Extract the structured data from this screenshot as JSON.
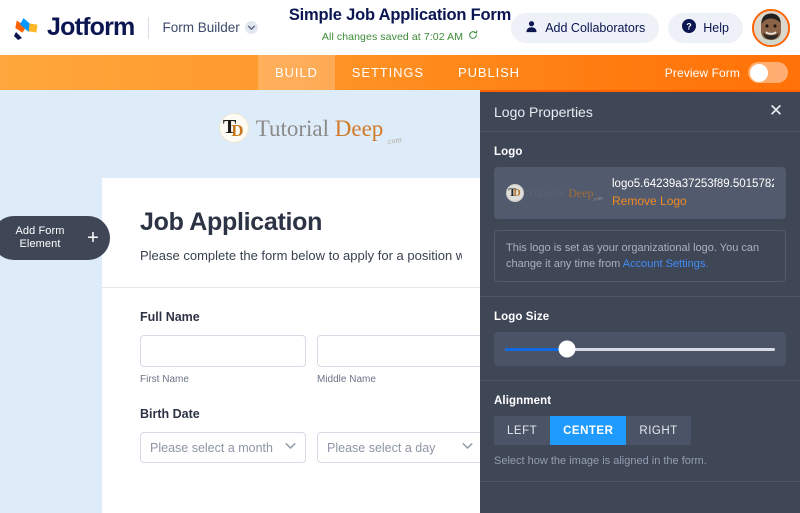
{
  "header": {
    "brand": "Jotform",
    "brand_icon": "jotform-logo-icon",
    "product_selector": "Form Builder",
    "product_selector_icon": "chevron-down-icon",
    "form_title": "Simple Job Application Form",
    "saved_status": "All changes saved at 7:02 AM",
    "saved_status_icon": "refresh-icon",
    "collaborators_label": "Add Collaborators",
    "collaborators_icon": "user-icon",
    "help_label": "Help",
    "help_icon": "question-circle-icon",
    "avatar_label": "avatar"
  },
  "navbar": {
    "tabs": [
      {
        "label": "BUILD",
        "active": true
      },
      {
        "label": "SETTINGS",
        "active": false
      },
      {
        "label": "PUBLISH",
        "active": false
      }
    ],
    "preview_label": "Preview Form",
    "preview_enabled": false
  },
  "workspace": {
    "add_element": {
      "line1": "Add Form",
      "line2": "Element",
      "icon": "plus-icon"
    },
    "form_logo": {
      "badge_t": "T",
      "badge_d": "D",
      "word_first": "Tutorial",
      "word_second": "Deep",
      "word_suffix": ".com"
    },
    "form": {
      "heading": "Job Application",
      "subheading": "Please complete the form below to apply for a position w",
      "fields": [
        {
          "label": "Full Name",
          "type": "text-pair",
          "inputs": [
            {
              "value": "",
              "placeholder": "",
              "sub_label": "First Name"
            },
            {
              "value": "",
              "placeholder": "",
              "sub_label": "Middle Name"
            }
          ]
        },
        {
          "label": "Birth Date",
          "type": "select-pair",
          "inputs": [
            {
              "value": "Please select a month",
              "sub_label": ""
            },
            {
              "value": "Please select a day",
              "sub_label": ""
            }
          ]
        }
      ]
    }
  },
  "panel": {
    "title": "Logo Properties",
    "close_icon": "close-icon",
    "logo_section": {
      "label": "Logo",
      "filename": "logo5.64239a37253f89.50157822....",
      "remove_label": "Remove Logo",
      "thumb_icon": "logo-thumbnail"
    },
    "info": {
      "text_before": "This logo is set as your organizational logo. You can change it any time from ",
      "link_text": "Account Settings.",
      "link_color": "#3f8cf5"
    },
    "size_section": {
      "label": "Logo Size",
      "value_percent": 23
    },
    "alignment_section": {
      "label": "Alignment",
      "options": [
        {
          "label": "LEFT",
          "active": false
        },
        {
          "label": "CENTER",
          "active": true
        },
        {
          "label": "RIGHT",
          "active": false
        }
      ],
      "hint": "Select how the image is aligned in the form."
    }
  },
  "colors": {
    "brand_navy": "#0a1551",
    "accent_orange": "#ff6100",
    "panel_bg": "#3f4757",
    "workspace_bg": "#deecf9",
    "active_blue": "#1f9bff",
    "saved_green": "#3d8b37"
  }
}
